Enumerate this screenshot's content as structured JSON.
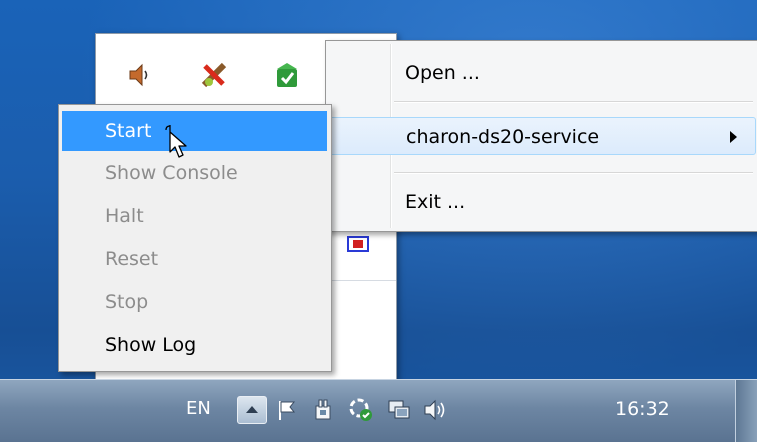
{
  "context_menu": {
    "items": [
      {
        "label": "Open ..."
      },
      {
        "label": "charon-ds20-service",
        "has_submenu": true,
        "highlighted": true
      },
      {
        "label": "Exit ..."
      }
    ]
  },
  "submenu": {
    "items": [
      {
        "label": "Start",
        "state": "highlighted"
      },
      {
        "label": "Show Console",
        "state": "disabled"
      },
      {
        "label": "Halt",
        "state": "disabled"
      },
      {
        "label": "Reset",
        "state": "disabled"
      },
      {
        "label": "Stop",
        "state": "disabled"
      },
      {
        "label": "Show Log",
        "state": "enabled"
      }
    ]
  },
  "taskbar": {
    "language": "EN",
    "clock": "16:32"
  },
  "tray_icons": [
    "speaker-icon",
    "network-error-icon",
    "app-check-icon",
    "service-icon"
  ],
  "taskbar_icons": [
    "flag-icon",
    "power-plug-icon",
    "sync-check-icon",
    "network-icon",
    "volume-icon"
  ],
  "colors": {
    "highlight": "#3399ff",
    "desktop": "#1b5dad",
    "disabled_text": "#8c8c8c"
  }
}
